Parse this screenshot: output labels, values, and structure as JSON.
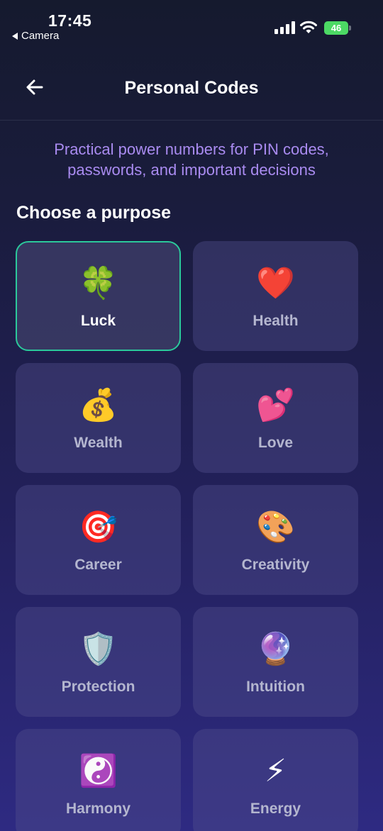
{
  "status": {
    "time": "17:45",
    "back_app": "Camera",
    "battery": "46"
  },
  "header": {
    "title": "Personal Codes"
  },
  "subtitle": "Practical power numbers for PIN codes, passwords, and important decisions",
  "section_title": "Choose a purpose",
  "purposes": [
    {
      "label": "Luck",
      "emoji": "🍀",
      "icon": "four-leaf-clover-icon",
      "selected": true
    },
    {
      "label": "Health",
      "emoji": "❤️",
      "icon": "heart-icon",
      "selected": false
    },
    {
      "label": "Wealth",
      "emoji": "💰",
      "icon": "money-bag-icon",
      "selected": false
    },
    {
      "label": "Love",
      "emoji": "💕",
      "icon": "two-hearts-icon",
      "selected": false
    },
    {
      "label": "Career",
      "emoji": "🎯",
      "icon": "target-icon",
      "selected": false
    },
    {
      "label": "Creativity",
      "emoji": "🎨",
      "icon": "palette-icon",
      "selected": false
    },
    {
      "label": "Protection",
      "emoji": "🛡️",
      "icon": "shield-icon",
      "selected": false
    },
    {
      "label": "Intuition",
      "emoji": "🔮",
      "icon": "crystal-ball-icon",
      "selected": false
    },
    {
      "label": "Harmony",
      "emoji": "☯️",
      "icon": "yin-yang-icon",
      "selected": false
    },
    {
      "label": "Energy",
      "emoji": "⚡",
      "icon": "lightning-icon",
      "selected": false
    }
  ],
  "colors": {
    "accent_border": "#2bc99b",
    "subtitle": "#a98bf0",
    "card_bg": "#3a3870"
  }
}
